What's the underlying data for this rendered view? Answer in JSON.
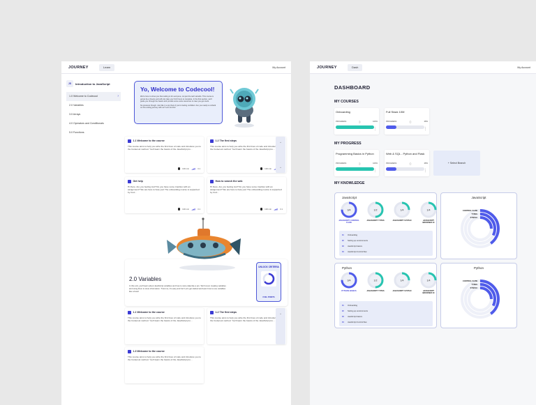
{
  "left": {
    "brand": "JOURNEY",
    "nav": "Learn",
    "account": "My Account",
    "course_badge": "JS",
    "course_title": "Introduction to JavaScript",
    "sidebar": [
      {
        "label": "1.0 Welcome to Codecool",
        "active": true
      },
      {
        "label": "2.0 Variables"
      },
      {
        "label": "3.0 Arrays"
      },
      {
        "label": "4.0 Operators and Conditionals"
      },
      {
        "label": "5.0 Functions"
      }
    ],
    "welcome": {
      "title": "Yo, Welcome to Codecool!",
      "p1": "We're here to show you that coding is for everyone, not just the tech wizards. This course is gonna be a breeze and will only take you 5-10 hours to complete. In the first section, we'll guide you through the basics and provide some extra resources in case you get stuck.",
      "p2": "No pressure though. Just like in a sip there if you're feeling confident. Are you ready to embark on this coding journey with us? Let's do this!"
    },
    "cards_top": [
      {
        "title": "1.1 Welcome to the course",
        "text": "This course aims to help you write the first lines of code and introduce you to the Codecool method. You'll learn the basics of the JavaScript pro...",
        "time": "100 min",
        "level": "3.1"
      },
      {
        "title": "1.2 The first steps",
        "text": "This course aims to help you write the first lines of code and introduce you to the Codecool method. You'll learn the basics of the JavaScript pro...",
        "time": "100 min",
        "level": "3.1"
      },
      {
        "title": "Get help",
        "text": "Hi there. Are you feeling lost? Do you have some troubles with an assignment? We are here to help you! The onboarding course is supported by Cod...",
        "time": "100 min",
        "level": "3.1"
      },
      {
        "title": "How to search the web",
        "text": "Hi there. Are you feeling lost? Do you have some troubles with an assignment? We are here to help you! The onboarding course is supported by Cod...",
        "time": "100 min",
        "level": "3.1"
      }
    ],
    "side_tab": "»",
    "variables": {
      "title": "2.0 Variables",
      "text": "In this unit, you'll learn about JavaScript variables and how to store data like a pro. We'll cover creating variables and using them to store information. Trust me, it's easy and fun! Let's get started and learn how to use variables like a boss!"
    },
    "unlock": {
      "label": "UNLOCK CRITERIA",
      "fuel": "FUEL POINTS",
      "progress": 0.65
    },
    "cards_bottom": [
      {
        "title": "1.1 Welcome to the course",
        "text": "This course aims to help you write the first lines of code and introduce you to the Codecool method. You'll learn the basics of the JavaScript pro..."
      },
      {
        "title": "1.2 The first steps",
        "text": "This course aims to help you write the first lines of code and introduce you to the Codecool method. You'll learn the basics of the JavaScript pro..."
      },
      {
        "title": "1.3 Welcome to the course",
        "text": "This course aims to help you write the first lines of code and introduce you to the Codecool method. You'll learn the basics of the JavaScript pro..."
      }
    ]
  },
  "right": {
    "brand": "JOURNEY",
    "nav": "Dash",
    "account": "My Account",
    "title": "DASHBOARD",
    "my_courses": "MY COURSES",
    "my_progress": "MY PROGRESS",
    "my_knowledge": "MY KNOWLEDGE",
    "progress_label": "PROGRESS",
    "courses": [
      {
        "name": "Onboarding",
        "percent": "100%",
        "progress": 1.0,
        "color": "#27c4b0"
      },
      {
        "name": "Full Stack 10M",
        "percent": "28%",
        "progress": 0.28,
        "color": "#4f5bea"
      }
    ],
    "progress": [
      {
        "name": "Programming Basics in Python",
        "percent": "100%",
        "progress": 1.0,
        "color": "#27c4b0"
      },
      {
        "name": "Web & SQL - Python and Flask",
        "percent": "28%",
        "progress": 0.28,
        "color": "#4f5bea"
      }
    ],
    "select_branch": "+ Select Branch",
    "knowledge": [
      {
        "title": "JavaScript",
        "gauges": [
          {
            "label": "JAVASCRIPT CONTROL FLOW",
            "value": "3/4",
            "active": true,
            "color": "#4f5bea",
            "fill": 0.75
          },
          {
            "label": "JAVASCRIPT TYPES",
            "value": "1/2",
            "color": "#27c4b0",
            "fill": 0.5
          },
          {
            "label": "JAVASCRIPT SYNTAX",
            "value": "1/4",
            "color": "#27c4b0",
            "fill": 0.25
          },
          {
            "label": "JAVASCRIPT BROWSER IO",
            "value": "1/4",
            "color": "#27c4b0",
            "fill": 0.25
          }
        ],
        "topics": [
          {
            "num": "01",
            "label": "Onboarding"
          },
          {
            "num": "02",
            "label": "Setting up environments"
          },
          {
            "num": "03",
            "label": "JavaScript basics"
          },
          {
            "num": "04",
            "label": "JavaScript Control flow"
          }
        ]
      },
      {
        "title": "Python",
        "gauges": [
          {
            "label": "PYTHON BASICS",
            "value": "3/4",
            "active": true,
            "color": "#4f5bea",
            "fill": 0.75
          },
          {
            "label": "JAVASCRIPT TYPES",
            "value": "1/2",
            "color": "#27c4b0",
            "fill": 0.5
          },
          {
            "label": "JAVASCRIPT SYNTAX",
            "value": "1/4",
            "color": "#27c4b0",
            "fill": 0.25
          },
          {
            "label": "JAVASCRIPT BROWSER IO",
            "value": "1/4",
            "color": "#27c4b0",
            "fill": 0.25
          }
        ],
        "topics": [
          {
            "num": "01",
            "label": "Onboarding"
          },
          {
            "num": "02",
            "label": "Setting up environments"
          },
          {
            "num": "03",
            "label": "JavaScript basics"
          },
          {
            "num": "04",
            "label": "JavaScript Control flow"
          }
        ]
      }
    ],
    "radials": [
      {
        "title": "JavaScript",
        "labels": [
          "CONTROL FLOW",
          "TYPES",
          "SYNTAX"
        ],
        "fills": [
          0.8,
          0.65,
          0.5
        ]
      },
      {
        "title": "Python",
        "labels": [
          "CONTROL FLOW",
          "TYPES",
          "SYNTAX"
        ],
        "fills": [
          0.8,
          0.65,
          0.5
        ]
      }
    ]
  }
}
